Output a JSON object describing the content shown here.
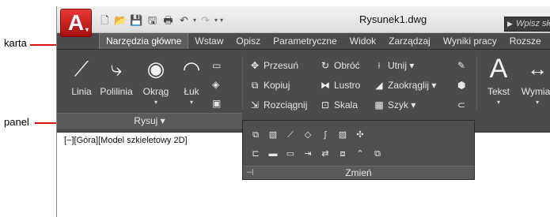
{
  "annotations": {
    "tab_label": "karta",
    "panel_label": "panel"
  },
  "app": {
    "logo": "A",
    "logo_caret": "▾",
    "document_title": "Rysunek1.dwg",
    "search_placeholder": "Wpisz sło"
  },
  "quick_access": [
    {
      "icon": "new-icon",
      "glyph": "🗋"
    },
    {
      "icon": "open-icon",
      "glyph": "📂"
    },
    {
      "icon": "save-icon",
      "glyph": "💾"
    },
    {
      "icon": "save-as-icon",
      "glyph": "🖫"
    },
    {
      "icon": "print-icon",
      "glyph": "🖶"
    },
    {
      "icon": "undo-icon",
      "glyph": "↶"
    },
    {
      "icon": "redo-icon",
      "glyph": "↷"
    }
  ],
  "tabs": [
    "Narzędzia główne",
    "Wstaw",
    "Opisz",
    "Parametryczne",
    "Widok",
    "Zarządzaj",
    "Wyniki pracy",
    "Rozsze"
  ],
  "draw_panel": {
    "title": "Rysuj",
    "title_caret": "▾",
    "large_buttons": [
      {
        "label": "Linia",
        "icon": "line-icon",
        "glyph": "⟋",
        "has_menu": false
      },
      {
        "label": "Polilinia",
        "icon": "polyline-icon",
        "glyph": "⤷",
        "has_menu": false
      },
      {
        "label": "Okrąg",
        "icon": "circle-icon",
        "glyph": "◉",
        "has_menu": true
      },
      {
        "label": "Łuk",
        "icon": "arc-icon",
        "glyph": "◠",
        "has_menu": true
      }
    ],
    "small_icons": [
      {
        "icon": "rectangle-icon",
        "glyph": "▭"
      },
      {
        "icon": "hatch-icon",
        "glyph": "◈"
      },
      {
        "icon": "region-icon",
        "glyph": "▣"
      }
    ]
  },
  "modify_panel": {
    "title": "Zmień",
    "buttons": [
      {
        "label": "Przesuń",
        "icon": "move-icon",
        "glyph": "✥"
      },
      {
        "label": "Kopiuj",
        "icon": "copy-icon",
        "glyph": "⧉"
      },
      {
        "label": "Rozciągnij",
        "icon": "stretch-icon",
        "glyph": "⇲"
      },
      {
        "label": "Obróć",
        "icon": "rotate-icon",
        "glyph": "↻"
      },
      {
        "label": "Lustro",
        "icon": "mirror-icon",
        "glyph": "⧓"
      },
      {
        "label": "Skala",
        "icon": "scale-icon",
        "glyph": "⊡"
      },
      {
        "label": "Utnij",
        "icon": "trim-icon",
        "glyph": "⟊"
      },
      {
        "label": "Zaokrąglij",
        "icon": "fillet-icon",
        "glyph": "◢"
      },
      {
        "label": "Szyk",
        "icon": "array-icon",
        "glyph": "▦"
      }
    ],
    "right_icons": [
      {
        "icon": "erase-icon",
        "glyph": "✎"
      },
      {
        "icon": "explode-icon",
        "glyph": "⬢"
      },
      {
        "icon": "offset-icon",
        "glyph": "⊂"
      }
    ],
    "popout_row1": [
      {
        "icon": "draworder-icon",
        "glyph": "⧉"
      },
      {
        "icon": "match-icon",
        "glyph": "▧"
      },
      {
        "icon": "lengthen-icon",
        "glyph": "⟋"
      },
      {
        "icon": "edit-spline-icon",
        "glyph": "◇"
      },
      {
        "icon": "polyline-edit-icon",
        "glyph": "∫"
      },
      {
        "icon": "hatch-edit-icon",
        "glyph": "▨"
      },
      {
        "icon": "align-icon",
        "glyph": "✣"
      }
    ],
    "popout_row2": [
      {
        "icon": "break-icon",
        "glyph": "⊏"
      },
      {
        "icon": "join-icon",
        "glyph": "▬"
      },
      {
        "icon": "break-at-point-icon",
        "glyph": "▭"
      },
      {
        "icon": "extend-icon",
        "glyph": "⇥"
      },
      {
        "icon": "reverse-icon",
        "glyph": "⇄"
      },
      {
        "icon": "overkill-icon",
        "glyph": "⧈"
      },
      {
        "icon": "blend-icon",
        "glyph": "⌃"
      },
      {
        "icon": "draw-order-menu-icon",
        "glyph": "⧉"
      }
    ],
    "pin_glyph": "⊣"
  },
  "annotation_panel": {
    "text_label": "Tekst",
    "text_glyph": "A",
    "dimension_label": "Wymiar",
    "dimension_glyph": "↔"
  },
  "viewport": {
    "label": "[−][Góra][Model szkieletowy 2D]"
  },
  "colors": {
    "ribbon": "#4b4b4b",
    "annotation_line": "#dd1111",
    "logo": "#c41b1b"
  }
}
